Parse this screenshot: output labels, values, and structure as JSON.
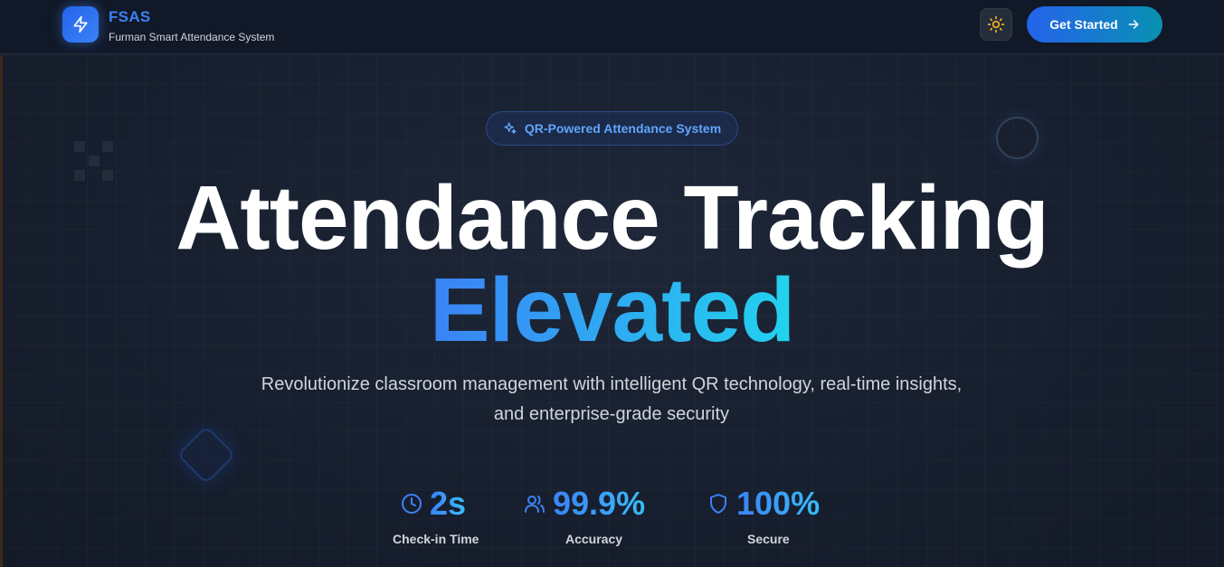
{
  "header": {
    "brand_title": "FSAS",
    "brand_subtitle": "Furman Smart Attendance System",
    "logo_icon": "bolt-icon",
    "theme_toggle_icon": "sun-icon",
    "cta_label": "Get Started",
    "cta_icon": "arrow-right-icon"
  },
  "hero": {
    "badge_label": "QR-Powered Attendance System",
    "badge_icon": "sparkles-icon",
    "title_line1": "Attendance Tracking",
    "title_line2": "Elevated",
    "subtitle": "Revolutionize classroom management with intelligent QR technology, real-time insights, and enterprise-grade security"
  },
  "stats": [
    {
      "icon": "clock-icon",
      "value": "2s",
      "label": "Check-in Time"
    },
    {
      "icon": "users-icon",
      "value": "99.9%",
      "label": "Accuracy"
    },
    {
      "icon": "shield-icon",
      "value": "100%",
      "label": "Secure"
    }
  ],
  "colors": {
    "background": "#141c2b",
    "header_bg": "#111827",
    "accent_blue": "#3b82f6",
    "accent_cyan": "#22d3ee",
    "sun_yellow": "#f5b81c"
  }
}
